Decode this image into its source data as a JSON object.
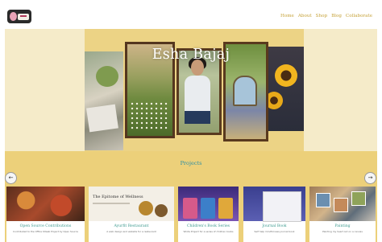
{
  "nav": {
    "items": [
      "Home",
      "About",
      "Shop",
      "Blog",
      "Collaborate"
    ]
  },
  "hero": {
    "title": "Esha Bajaj"
  },
  "projects": {
    "heading": "Projects",
    "prev_arrow": "←",
    "next_arrow": "→",
    "cards": [
      {
        "title": "Open Source Contributions",
        "desc": "Contributed to the Office Kitaab Project by Open Source"
      },
      {
        "title": "Ayurfit Restaurant",
        "desc": "A web design and website for a restaurant"
      },
      {
        "title": "Children's Book Series",
        "desc": "Wrote Project for a series of children books"
      },
      {
        "title": "Journal Book",
        "desc": "Self help mindfulness journal book"
      },
      {
        "title": "Painting",
        "desc": "Painting my heart out on a canvas"
      }
    ],
    "card2_heading": "The Epitome of Wellness"
  },
  "colors": {
    "accent": "#c6a33a",
    "projects_bg": "#ecd07a",
    "heading_teal": "#2f8fa3"
  }
}
